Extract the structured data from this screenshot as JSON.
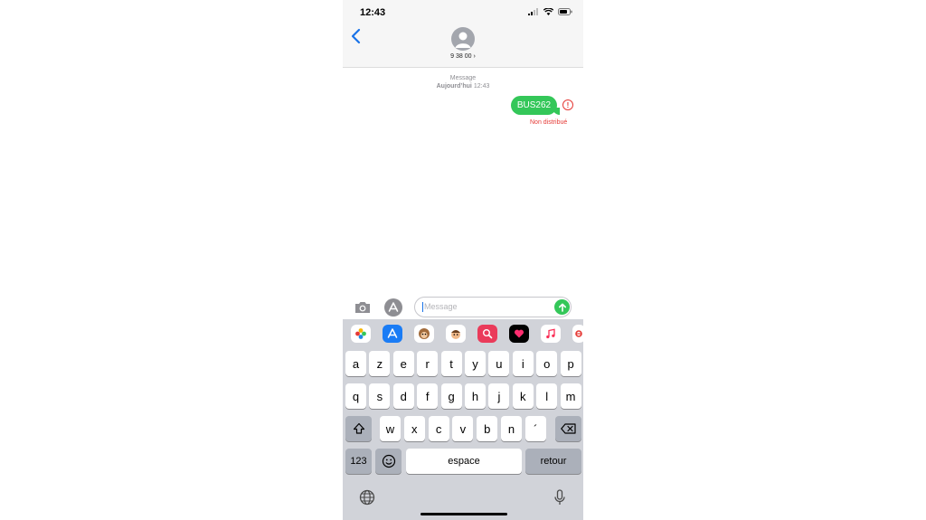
{
  "status_bar": {
    "time": "12:43"
  },
  "header": {
    "back_icon": "chevron-left-icon",
    "contact_name": "9 38 00 ›"
  },
  "conversation": {
    "service_label": "Message",
    "date_prefix": "Aujourd’hui",
    "date_time": "12:43",
    "messages": [
      {
        "text": "BUS262",
        "status": "Non distribué",
        "error_icon": "!"
      }
    ]
  },
  "composer": {
    "placeholder": "Message",
    "camera_icon": "camera-icon",
    "apps_icon": "app-store-icon",
    "send_icon": "send-arrow-icon"
  },
  "app_strip": [
    "photos-icon",
    "app-store-icon",
    "animoji-icon",
    "memoji-icon",
    "images-search-icon",
    "digital-touch-icon",
    "music-icon",
    "ebay-icon"
  ],
  "keyboard": {
    "row1": [
      "a",
      "z",
      "e",
      "r",
      "t",
      "y",
      "u",
      "i",
      "o",
      "p"
    ],
    "row2": [
      "q",
      "s",
      "d",
      "f",
      "g",
      "h",
      "j",
      "k",
      "l",
      "m"
    ],
    "row3": [
      "w",
      "x",
      "c",
      "v",
      "b",
      "n",
      "´"
    ],
    "numbers": "123",
    "space": "espace",
    "return": "retour"
  },
  "colors": {
    "accent_green": "#34c759",
    "error_red": "#e53935",
    "link_blue": "#1a73e8"
  }
}
